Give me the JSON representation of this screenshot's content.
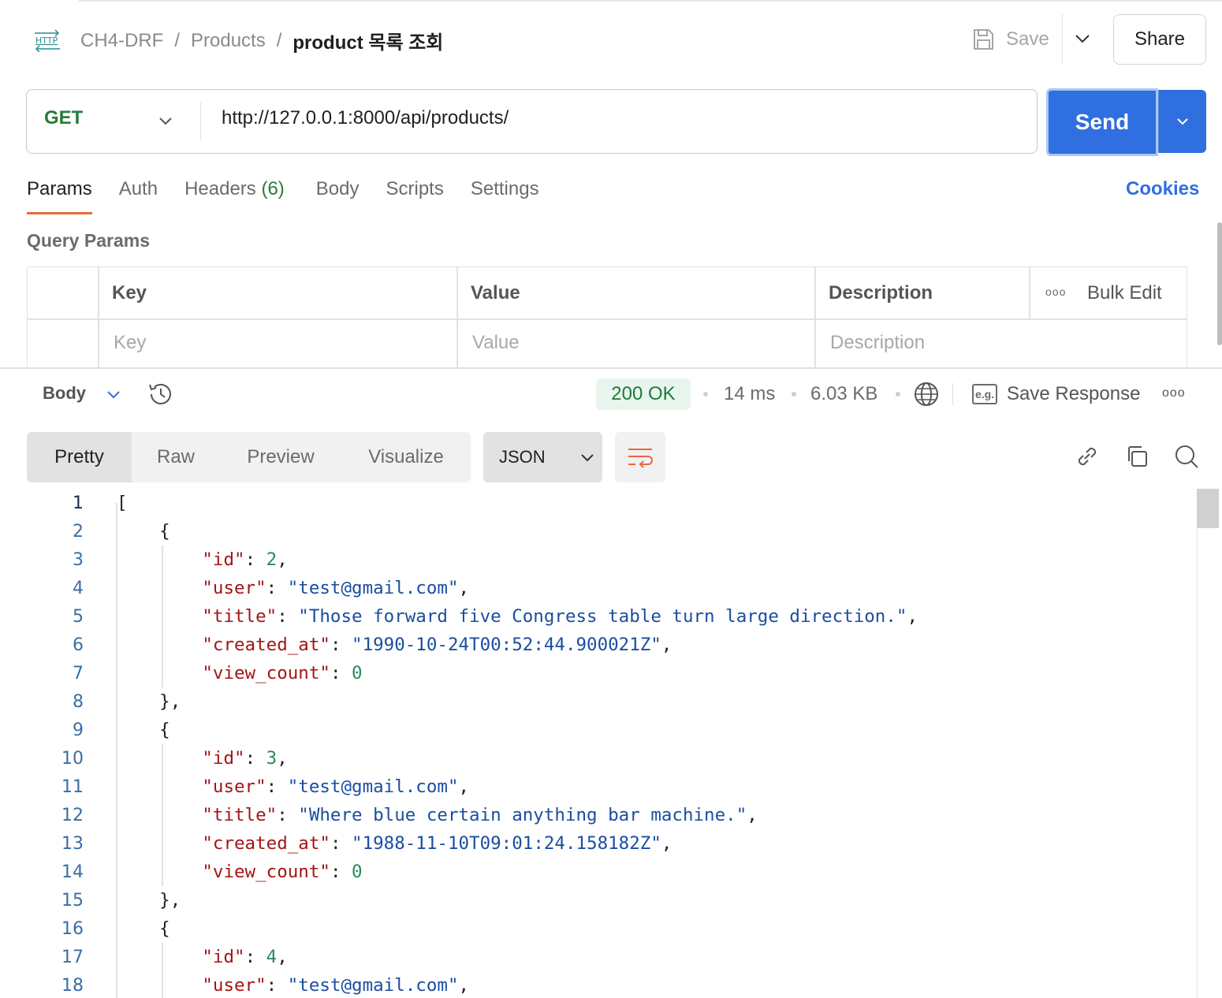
{
  "header": {
    "icon": "http-icon",
    "icon_text": "HTTP",
    "breadcrumb": [
      "CH4-DRF",
      "Products",
      "product 목록 조회"
    ],
    "separator": "/",
    "save_label": "Save",
    "share_label": "Share"
  },
  "request": {
    "method": "GET",
    "url": "http://127.0.0.1:8000/api/products/",
    "send_label": "Send",
    "accent_color": "#2f6fdf"
  },
  "request_tabs": {
    "params": "Params",
    "auth": "Auth",
    "headers": "Headers",
    "headers_count": "(6)",
    "body": "Body",
    "scripts": "Scripts",
    "settings": "Settings",
    "cookies": "Cookies"
  },
  "query_params": {
    "title": "Query Params",
    "columns": [
      "Key",
      "Value",
      "Description"
    ],
    "placeholders": [
      "Key",
      "Value",
      "Description"
    ],
    "bulk_edit": "Bulk Edit"
  },
  "response": {
    "section_label": "Body",
    "status": "200 OK",
    "status_color": "#1f7a3a",
    "time": "14 ms",
    "size": "6.03 KB",
    "example_icon": "e.g.",
    "save_response": "Save Response",
    "view_tabs": [
      "Pretty",
      "Raw",
      "Preview",
      "Visualize"
    ],
    "active_view": "Pretty",
    "format": "JSON"
  },
  "code_lines": [
    "[",
    "    {",
    "        \"id\": 2,",
    "        \"user\": \"test@gmail.com\",",
    "        \"title\": \"Those forward five Congress table turn large direction.\",",
    "        \"created_at\": \"1990-10-24T00:52:44.900021Z\",",
    "        \"view_count\": 0",
    "    },",
    "    {",
    "        \"id\": 3,",
    "        \"user\": \"test@gmail.com\",",
    "        \"title\": \"Where blue certain anything bar machine.\",",
    "        \"created_at\": \"1988-11-10T09:01:24.158182Z\",",
    "        \"view_count\": 0",
    "    },",
    "    {",
    "        \"id\": 4,",
    "        \"user\": \"test@gmail.com\","
  ]
}
